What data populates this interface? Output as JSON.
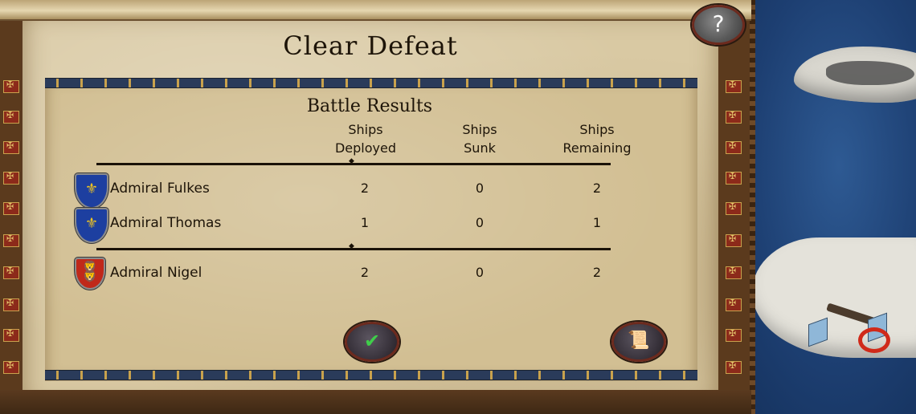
{
  "title": "Clear Defeat",
  "results": {
    "subtitle": "Battle Results",
    "columns": [
      {
        "line1": "Ships",
        "line2": "Deployed"
      },
      {
        "line1": "Ships",
        "line2": "Sunk"
      },
      {
        "line1": "Ships",
        "line2": "Remaining"
      }
    ],
    "allies": [
      {
        "name": "Admiral Fulkes",
        "deployed": "2",
        "sunk": "0",
        "remaining": "2",
        "crest": "blue-fleur-de-lis"
      },
      {
        "name": "Admiral Thomas",
        "deployed": "1",
        "sunk": "0",
        "remaining": "1",
        "crest": "blue-fleur-de-lis"
      }
    ],
    "enemies": [
      {
        "name": "Admiral Nigel",
        "deployed": "2",
        "sunk": "0",
        "remaining": "2",
        "crest": "red-three-lions"
      }
    ]
  },
  "buttons": {
    "help": "?",
    "ok_icon": "checkmark-icon",
    "log_icon": "scroll-icon"
  },
  "colors": {
    "parchment": "#d9c9a3",
    "frame": "#5a3a20",
    "ok_green": "#3fce4a",
    "ally_blue": "#1d3fa0",
    "enemy_red": "#c0281a"
  }
}
